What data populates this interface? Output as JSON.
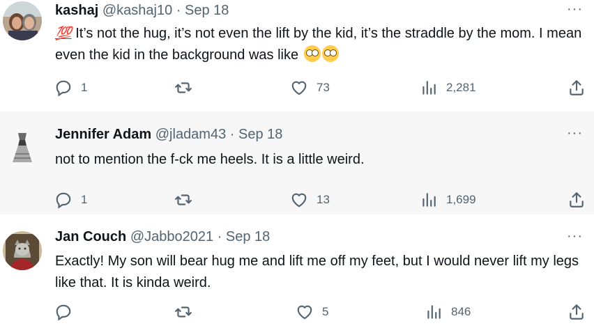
{
  "tweets": [
    {
      "name": "kashaj",
      "handle": "@kashaj10",
      "separator": "·",
      "date": "Sep 18",
      "text_emoji": "💯",
      "text": " It’s not the hug, it’s not even the lift by the kid, it’s the straddle by the mom. I mean even the kid in the background was like ",
      "replies": "1",
      "retweets": "",
      "likes": "73",
      "views": "2,281"
    },
    {
      "name": "Jennifer Adam",
      "handle": "@jladam43",
      "separator": "·",
      "date": "Sep 18",
      "text": "not to mention the f-ck me heels. It is a little weird.",
      "replies": "1",
      "retweets": "",
      "likes": "13",
      "views": "1,699"
    },
    {
      "name": "Jan Couch",
      "handle": "@Jabbo2021",
      "separator": "·",
      "date": "Sep 18",
      "text": "Exactly! My son will bear hug me and lift me off my feet, but I would never lift my legs like that. It is kinda weird.",
      "replies": "",
      "retweets": "",
      "likes": "5",
      "views": "846"
    }
  ],
  "more_label": "···",
  "icons": [
    "reply-icon",
    "retweet-icon",
    "like-icon",
    "views-icon",
    "share-icon",
    "more-icon",
    "flushed-face-emoji"
  ],
  "colors": {
    "text": "#0f1419",
    "muted": "#536471",
    "hundred_red": "#d12a2a",
    "row_highlight": "#f7f7f7"
  }
}
